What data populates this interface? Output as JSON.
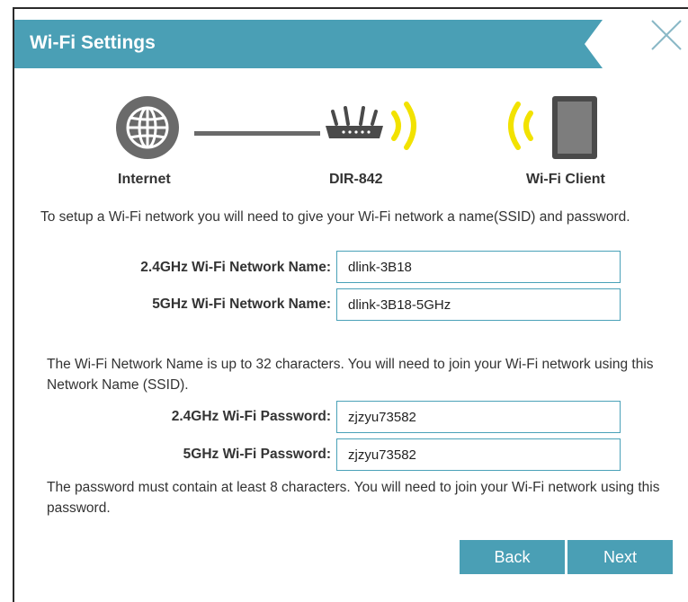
{
  "dialog": {
    "title": "Wi-Fi Settings"
  },
  "diagram": {
    "internet_label": "Internet",
    "router_label": "DIR-842",
    "client_label": "Wi-Fi Client"
  },
  "intro_text": "To setup a Wi-Fi network you will need to give your Wi-Fi network a name(SSID) and password.",
  "fields": {
    "ssid_24": {
      "label": "2.4GHz Wi-Fi Network Name:",
      "value": "dlink-3B18"
    },
    "ssid_5": {
      "label": "5GHz Wi-Fi Network Name:",
      "value": "dlink-3B18-5GHz"
    },
    "pass_24": {
      "label": "2.4GHz Wi-Fi Password:",
      "value": "zjzyu73582"
    },
    "pass_5": {
      "label": "5GHz Wi-Fi Password:",
      "value": "zjzyu73582"
    }
  },
  "name_help_text": "The Wi-Fi Network Name is up to 32 characters. You will need to join your Wi-Fi network using this Network Name (SSID).",
  "password_help_text": "The password must contain at least 8 characters. You will need to join your Wi-Fi network using this password.",
  "buttons": {
    "back": "Back",
    "next": "Next"
  },
  "colors": {
    "accent": "#4a9fb5",
    "wifi_signal": "#f2e200"
  },
  "icons": [
    "globe-icon",
    "router-icon",
    "wifi-signal-icon",
    "tablet-icon",
    "close-icon"
  ]
}
